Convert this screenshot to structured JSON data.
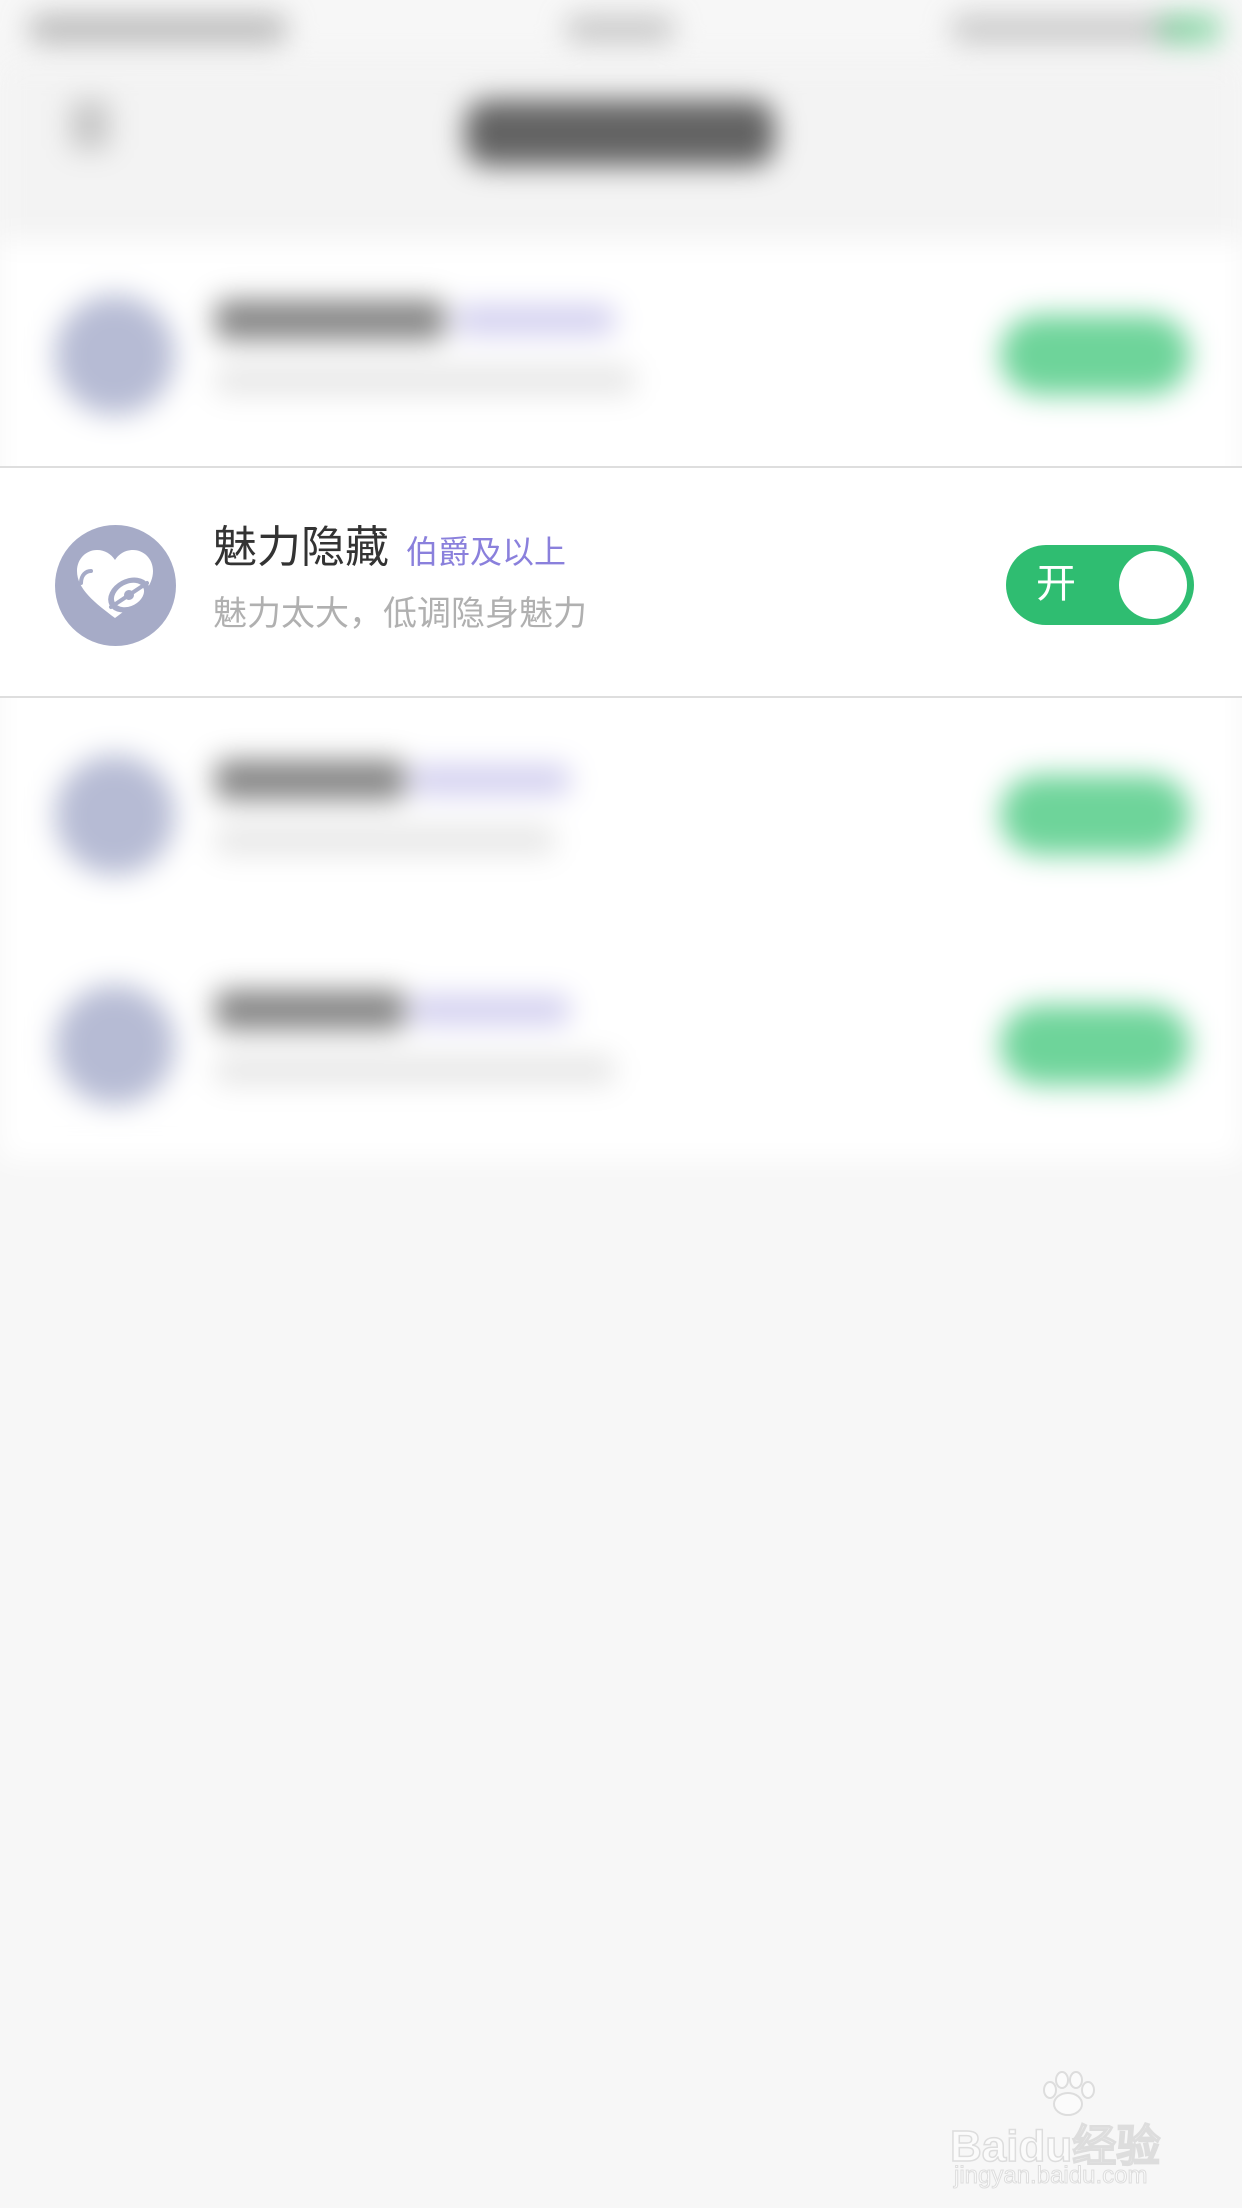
{
  "focused_setting": {
    "title": "魅力隐藏",
    "tag": "伯爵及以上",
    "description": "魅力太大，低调隐身魅力",
    "toggle_label": "开",
    "toggle_on": true,
    "icon": "heart-hidden-icon"
  },
  "colors": {
    "toggle_on": "#2fbd71",
    "tag": "#8a80dc",
    "icon_bg": "#a6abc7"
  },
  "watermark": {
    "main": "Baidu经验",
    "sub": "jingyan.baidu.com"
  }
}
